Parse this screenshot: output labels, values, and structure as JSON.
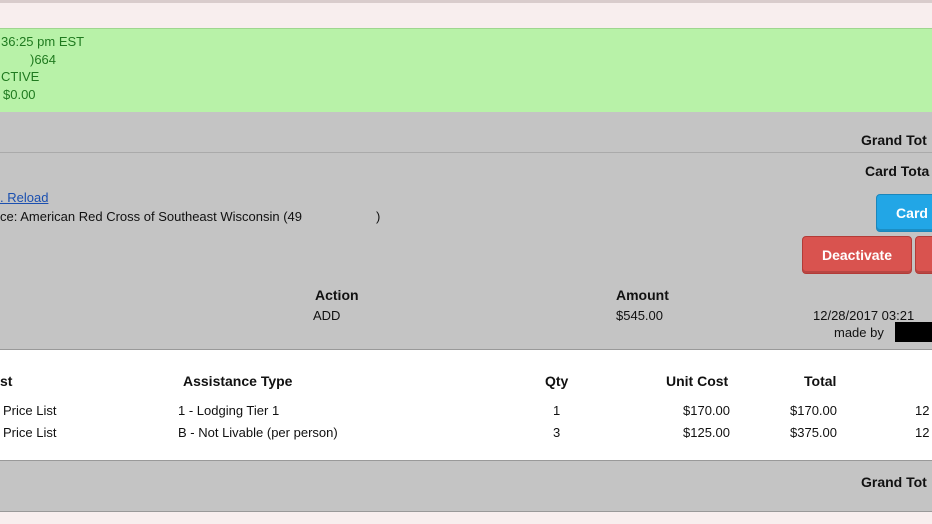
{
  "status": {
    "time_text": "36:25 pm EST",
    "id_text": ")664",
    "state_text": "CTIVE",
    "balance_text": "$0.00"
  },
  "summary": {
    "grand_total_label": "Grand Tot"
  },
  "card": {
    "card_total_label": "Card Tota",
    "reload_link": ". Reload",
    "service_text": "ce: American Red Cross of Southeast Wisconsin (49",
    "service_close": ")",
    "card_button": "Card",
    "deactivate_button": "Deactivate",
    "action_header": "Action",
    "action_value": "ADD",
    "amount_header": "Amount",
    "amount_value": "$545.00",
    "date_value": "12/28/2017 03:21",
    "made_by": "made by"
  },
  "items": {
    "headers": [
      "st",
      "Assistance Type",
      "Qty",
      "Unit Cost",
      "Total"
    ],
    "rows": [
      {
        "list": "Price List",
        "type": "1 - Lodging Tier 1",
        "qty": "1",
        "unit": "$170.00",
        "total": "$170.00",
        "date": "12"
      },
      {
        "list": "Price List",
        "type": "B - Not Livable (per person)",
        "qty": "3",
        "unit": "$125.00",
        "total": "$375.00",
        "date": "12"
      }
    ]
  },
  "footer": {
    "grand_total_label": "Grand Tot"
  },
  "colors": {
    "status_bg": "#b8f2a8",
    "status_text": "#1f7a1f",
    "blue_button": "#22a6e6",
    "red_button": "#d9534f",
    "panel_gray": "#c4c4c4"
  }
}
